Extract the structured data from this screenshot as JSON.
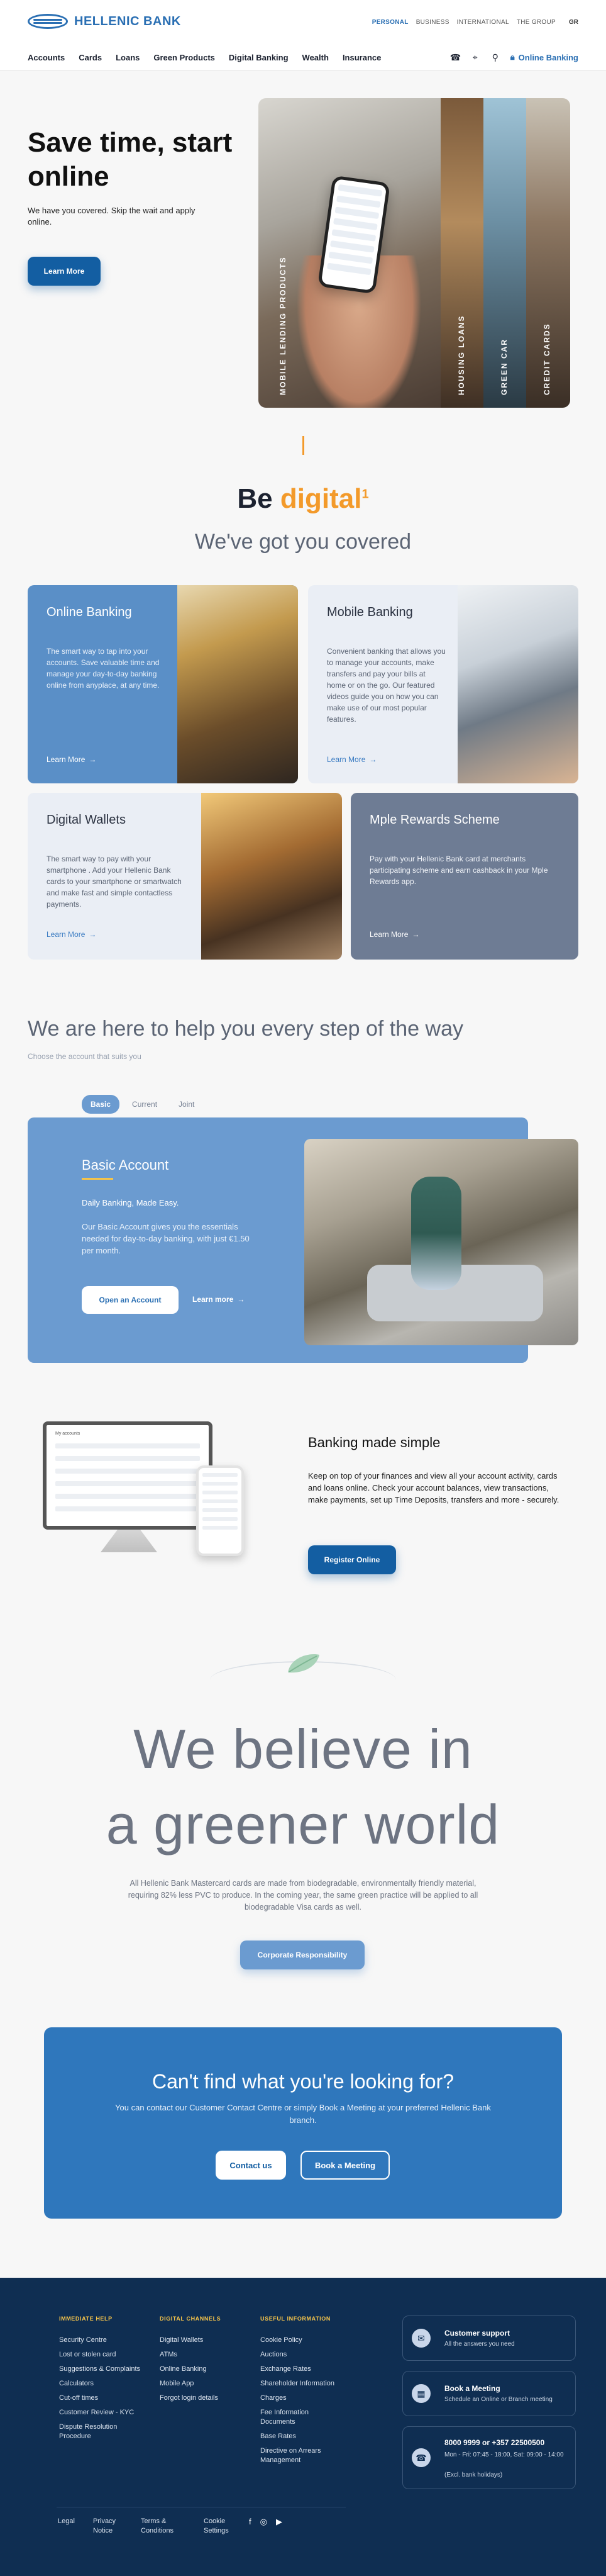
{
  "header": {
    "brand": "HELLENIC BANK",
    "segments": [
      "PERSONAL",
      "BUSINESS",
      "INTERNATIONAL",
      "THE GROUP"
    ],
    "language": "GR",
    "nav": [
      "Accounts",
      "Cards",
      "Loans",
      "Green Products",
      "Digital Banking",
      "Wealth",
      "Insurance"
    ],
    "online_banking": "Online Banking"
  },
  "hero": {
    "title": "Save time, start online",
    "subtitle": "We have you covered. Skip the wait and apply online.",
    "button": "Learn More",
    "panels": [
      "MOBILE LENDING PRODUCTS",
      "HOUSING LOANS",
      "GREEN CAR",
      "CREDIT CARDS"
    ]
  },
  "digital": {
    "be": "Be",
    "digital_word": "digital",
    "superscript": "1",
    "subtitle": "We've got you covered"
  },
  "cards": [
    {
      "title": "Online Banking",
      "desc": "The smart way to tap into your accounts. Save valuable time and manage your day-to-day banking online from anyplace, at any time.",
      "link": "Learn More"
    },
    {
      "title": "Mobile Banking",
      "desc": "Convenient banking that allows you to manage your accounts, make transfers and pay your bills at home or on the go. Our featured videos guide you on how you can make use of our most popular features.",
      "link": "Learn More"
    },
    {
      "title": "Digital Wallets",
      "desc": "The smart way to pay with your smartphone . Add your Hellenic Bank cards to your smartphone or smartwatch and make fast and simple contactless payments.",
      "link": "Learn More"
    },
    {
      "title": "Mple Rewards Scheme",
      "desc": "Pay with your Hellenic Bank card at merchants participating scheme and earn cashback in your Mple Rewards app.",
      "link": "Learn More"
    }
  ],
  "help": {
    "title": "We are here to help you every step of the way",
    "subtitle": "Choose the account that suits you",
    "tabs": [
      "Basic",
      "Current",
      "Joint"
    ],
    "account_title": "Basic Account",
    "tagline": "Daily Banking, Made Easy.",
    "desc": "Our Basic Account gives you the essentials needed for day-to-day banking, with just €1.50 per month.",
    "open_button": "Open an Account",
    "learn_more": "Learn more"
  },
  "banking_simple": {
    "title": "Banking made simple",
    "desc": "Keep on top of your finances and view all your account activity, cards and loans online. Check your account balances, view transactions, make payments, set up Time Deposits, transfers and more - securely.",
    "button": "Register Online",
    "screen_heading": "My accounts"
  },
  "green": {
    "line1": "We believe in",
    "line2": "a greener world",
    "desc": "All Hellenic Bank Mastercard cards are made from biodegradable, environmentally friendly material, requiring 82% less PVC to produce. In the coming year, the same green practice will be applied to all biodegradable Visa cards as well.",
    "button": "Corporate Responsibility"
  },
  "cta": {
    "title": "Can't find what you're looking for?",
    "desc": "You can contact our Customer Contact Centre or simply Book a Meeting at your preferred Hellenic Bank branch.",
    "contact": "Contact us",
    "meeting": "Book a Meeting"
  },
  "footer": {
    "cols": [
      {
        "head": "IMMEDIATE HELP",
        "items": [
          "Security Centre",
          "Lost or stolen card",
          "Suggestions & Complaints",
          "Calculators",
          "Cut-off times",
          "Customer Review - KYC",
          "Dispute Resolution Procedure"
        ]
      },
      {
        "head": "DIGITAL CHANNELS",
        "items": [
          "Digital Wallets",
          "ATMs",
          "Online Banking",
          "Mobile App",
          "Forgot login details"
        ]
      },
      {
        "head": "USEFUL INFORMATION",
        "items": [
          "Cookie Policy",
          "Auctions",
          "Exchange Rates",
          "Shareholder Information",
          "Charges",
          "Fee Information Documents",
          "Base Rates",
          "Directive on Arrears Management"
        ]
      }
    ],
    "support_title": "Customer support",
    "support_sub": "All the answers you need",
    "meeting_title": "Book a Meeting",
    "meeting_sub": "Schedule an Online or Branch meeting",
    "phone_title": "8000 9999 or +357 22500500",
    "phone_hours": "Mon - Fri: 07:45 - 18:00, Sat: 09:00 - 14:00",
    "phone_note": "(Excl. bank holidays)",
    "bottom": [
      "Legal",
      "Privacy Notice",
      "Terms & Conditions",
      "Cookie Settings"
    ]
  }
}
